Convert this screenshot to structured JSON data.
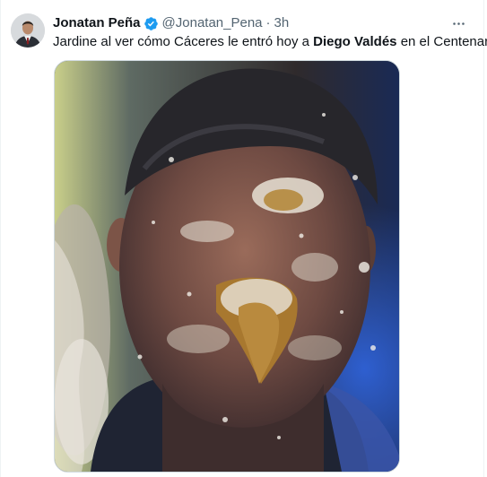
{
  "author": {
    "display_name": "Jonatan Peña",
    "handle": "@Jonatan_Pena",
    "separator": "·",
    "time": "3h",
    "verified": true
  },
  "tweet": {
    "text_before": "Jardine al ver cómo Cáceres le entró hoy a ",
    "text_bold": "Diego Valdés",
    "text_after": " en el Centenario"
  },
  "media": {
    "subject": "man-face-covered-in-cake"
  },
  "icons": {
    "verified": "verified-badge-icon",
    "more": "more-options-icon"
  },
  "colors": {
    "verified_blue": "#1d9bf0",
    "secondary_text": "#536471",
    "primary_text": "#0f1419",
    "border": "#cfd9de"
  }
}
